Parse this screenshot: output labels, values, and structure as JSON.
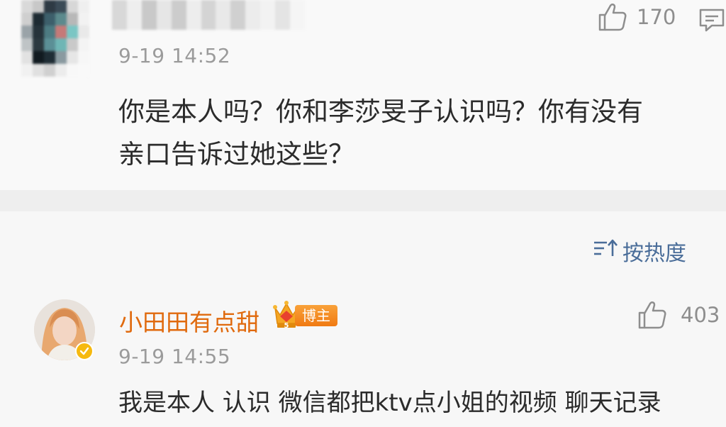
{
  "comment_top": {
    "time": "9-19 14:52",
    "likes": "170",
    "text_line1": "你是本人吗？你和李莎旻子认识吗？你有没有",
    "text_line2": "亲口告诉过她这些？"
  },
  "sort": {
    "label": "按热度"
  },
  "comment_2": {
    "username": "小田田有点甜",
    "badge_label": "博主",
    "crown_level": "5",
    "likes": "403",
    "time": "9-19 14:55",
    "text": "我是本人 认识 微信都把ktv点小姐的视频 聊天记录"
  },
  "colors": {
    "username": "#e06a0e",
    "sort_link": "#4a6d99",
    "meta_gray": "#9b9b9b",
    "text": "#2b2b2b"
  },
  "icons": [
    "thumbs-up-icon",
    "reply-icon",
    "sort-icon",
    "crown-icon",
    "verified-icon"
  ]
}
